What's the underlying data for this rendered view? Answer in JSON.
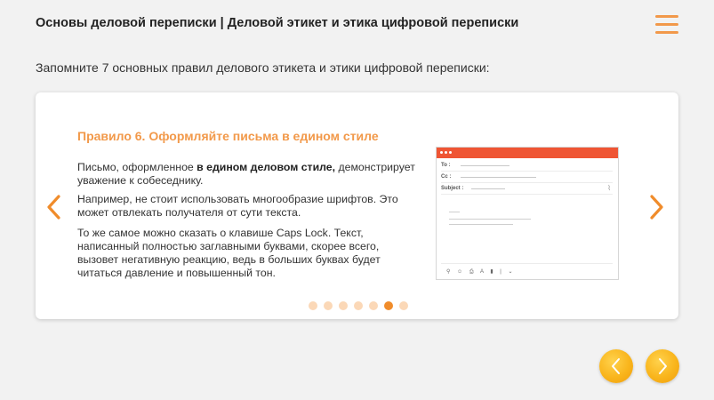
{
  "header": {
    "title": "Основы деловой переписки  | Деловой этикет и этика цифровой переписки",
    "menu_icon": "hamburger-menu-icon"
  },
  "subtitle": "Запомните 7 основных правил делового этикета и этики цифровой переписки:",
  "slide": {
    "title": "Правило 6. Оформляйте письма в едином стиле",
    "p1_before": "Письмо, оформленное ",
    "p1_bold": "в едином деловом стиле,",
    "p1_after": " демонстрирует уважение к собеседнику.",
    "p2": "Например, не стоит использовать многообразие шрифтов. Это может отвлекать получателя от сути текста.",
    "p3": "То же самое можно сказать о клавише Caps Lock. Текст, написанный полностью заглавными буквами, скорее всего, вызовет негативную реакцию, ведь в больших буквах будет читаться давление и повышенный тон.",
    "email": {
      "to_label": "To :",
      "cc_label": "Cc :",
      "subject_label": "Subject :",
      "footer_icons": "⚲ ☺ ⎙ A ▮ | ⌄"
    }
  },
  "carousel": {
    "total": 7,
    "current": 6
  },
  "colors": {
    "accent": "#f2994a",
    "dot_active": "#f08c2b",
    "dot_inactive": "#fbd8b7",
    "email_bar": "#ef5534",
    "nav_button": "#f9b51c"
  },
  "icons": {
    "prev": "chevron-left-icon",
    "next": "chevron-right-icon"
  }
}
